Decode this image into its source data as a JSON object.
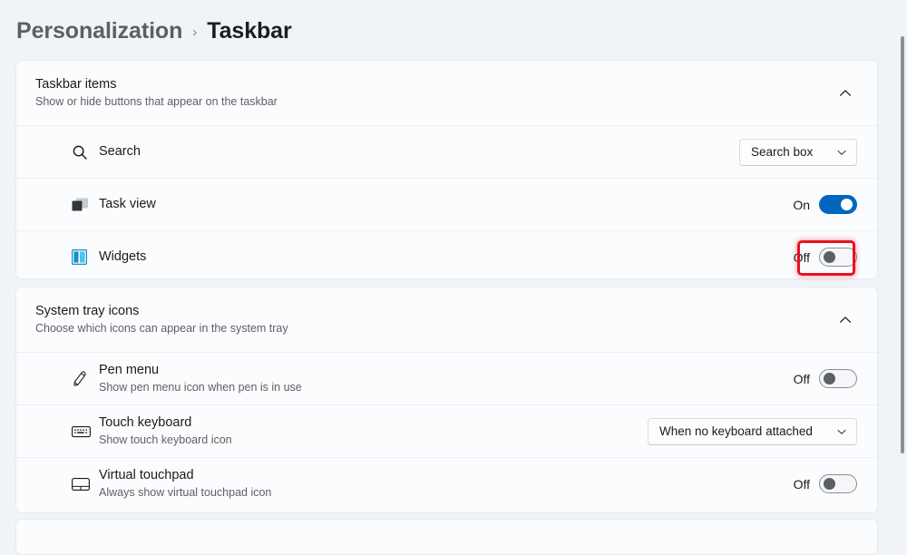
{
  "breadcrumb": {
    "parent": "Personalization",
    "separator": "›",
    "current": "Taskbar"
  },
  "groups": [
    {
      "id": "taskbar-items",
      "title": "Taskbar items",
      "subtitle": "Show or hide buttons that appear on the taskbar",
      "expand_icon": "chevron-up-icon",
      "rows": [
        {
          "id": "search",
          "icon": "search-icon",
          "title": "Search",
          "subtitle": "",
          "control": "dropdown",
          "value": "Search box"
        },
        {
          "id": "task-view",
          "icon": "task-view-icon",
          "title": "Task view",
          "subtitle": "",
          "control": "toggle",
          "state_label": "On",
          "state": "on"
        },
        {
          "id": "widgets",
          "icon": "widgets-icon",
          "title": "Widgets",
          "subtitle": "",
          "control": "toggle",
          "state_label": "Off",
          "state": "off",
          "highlighted": true
        }
      ]
    },
    {
      "id": "system-tray-icons",
      "title": "System tray icons",
      "subtitle": "Choose which icons can appear in the system tray",
      "expand_icon": "chevron-up-icon",
      "rows": [
        {
          "id": "pen-menu",
          "icon": "pen-icon",
          "title": "Pen menu",
          "subtitle": "Show pen menu icon when pen is in use",
          "control": "toggle",
          "state_label": "Off",
          "state": "off"
        },
        {
          "id": "touch-keyboard",
          "icon": "keyboard-icon",
          "title": "Touch keyboard",
          "subtitle": "Show touch keyboard icon",
          "control": "dropdown",
          "value": "When no keyboard attached"
        },
        {
          "id": "virtual-touchpad",
          "icon": "touchpad-icon",
          "title": "Virtual touchpad",
          "subtitle": "Always show virtual touchpad icon",
          "control": "toggle",
          "state_label": "Off",
          "state": "off"
        }
      ]
    }
  ],
  "colors": {
    "page_background": "#f0f3f8",
    "card_background": "#fbfcfe",
    "accent_toggle_on": "#0067c0",
    "highlight_annotation": "#e81123",
    "text_primary": "#1b1b1b",
    "text_secondary": "#5c5f63"
  },
  "scrollbar": {
    "name": "vertical-scrollbar"
  }
}
